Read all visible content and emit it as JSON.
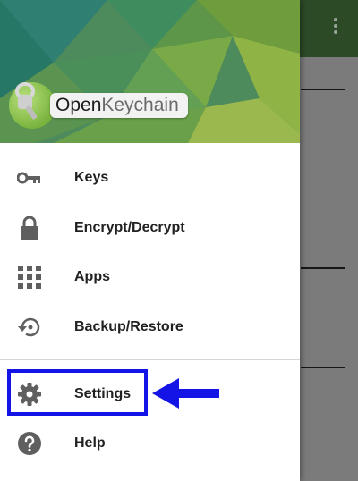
{
  "app": {
    "logo_word_1": "Open",
    "logo_word_2": "Keychain"
  },
  "drawer": {
    "items": [
      {
        "label": "Keys",
        "icon": "key-icon"
      },
      {
        "label": "Encrypt/Decrypt",
        "icon": "lock-icon"
      },
      {
        "label": "Apps",
        "icon": "apps-grid-icon"
      },
      {
        "label": "Backup/Restore",
        "icon": "backup-restore-icon"
      },
      {
        "label": "Settings",
        "icon": "gear-icon"
      },
      {
        "label": "Help",
        "icon": "help-icon"
      }
    ]
  },
  "colors": {
    "annotation": "#1414e6",
    "toolbar": "#2c4a26",
    "icon": "#5f5f5f"
  }
}
